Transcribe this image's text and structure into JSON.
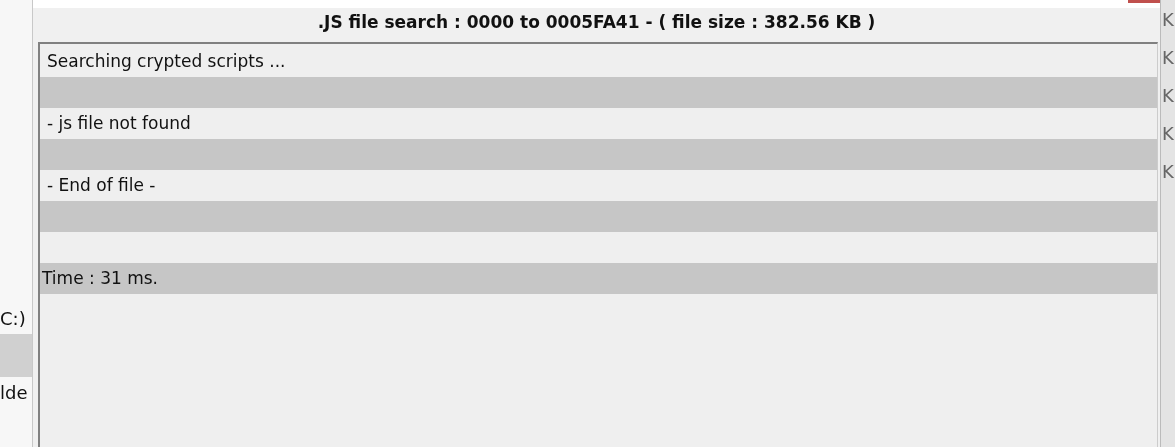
{
  "background_window_left": {
    "items": [
      {
        "text": "C:)",
        "selected": false
      },
      {
        "selected": true
      },
      {
        "text": "lde",
        "selected": false
      }
    ]
  },
  "dialog": {
    "title": ".JS file search : 0000 to 0005FA41 - ( file size : 382.56 KB )",
    "log_rows": [
      {
        "text": "Searching crypted scripts ...",
        "shaded": false
      },
      {
        "shaded": true
      },
      {
        "text": "- js file not found",
        "shaded": false
      },
      {
        "shaded": true
      },
      {
        "text": "- End of file -",
        "shaded": false
      },
      {
        "shaded": true
      },
      {
        "shaded": false
      },
      {
        "text": "Time : 31 ms.",
        "shaded": true
      }
    ]
  },
  "background_window_right": {
    "items": [
      "K",
      "K",
      "K",
      "K",
      "K"
    ]
  }
}
